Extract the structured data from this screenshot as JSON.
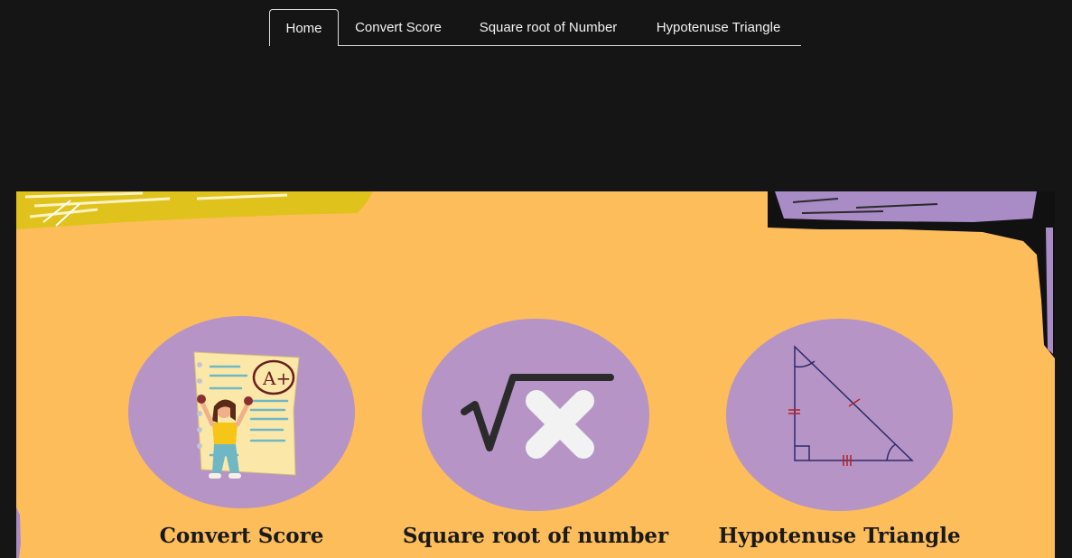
{
  "nav": {
    "items": [
      {
        "label": "Home",
        "active": true
      },
      {
        "label": "Convert Score",
        "active": false
      },
      {
        "label": "Square root of Number",
        "active": false
      },
      {
        "label": "Hypotenuse Triangle",
        "active": false
      }
    ]
  },
  "colors": {
    "page_background": "#151515",
    "banner_background": "#fdbd5b",
    "circle_fill": "#b794c6",
    "accent_yellow": "#e0c21c",
    "accent_purple": "#a98bc6"
  },
  "cards": [
    {
      "title": "Convert Score",
      "icon": "graded-paper-girl-icon"
    },
    {
      "title": "Square  root of number",
      "icon": "square-root-x-icon"
    },
    {
      "title": "Hypotenuse Triangle",
      "icon": "right-triangle-icon"
    }
  ]
}
